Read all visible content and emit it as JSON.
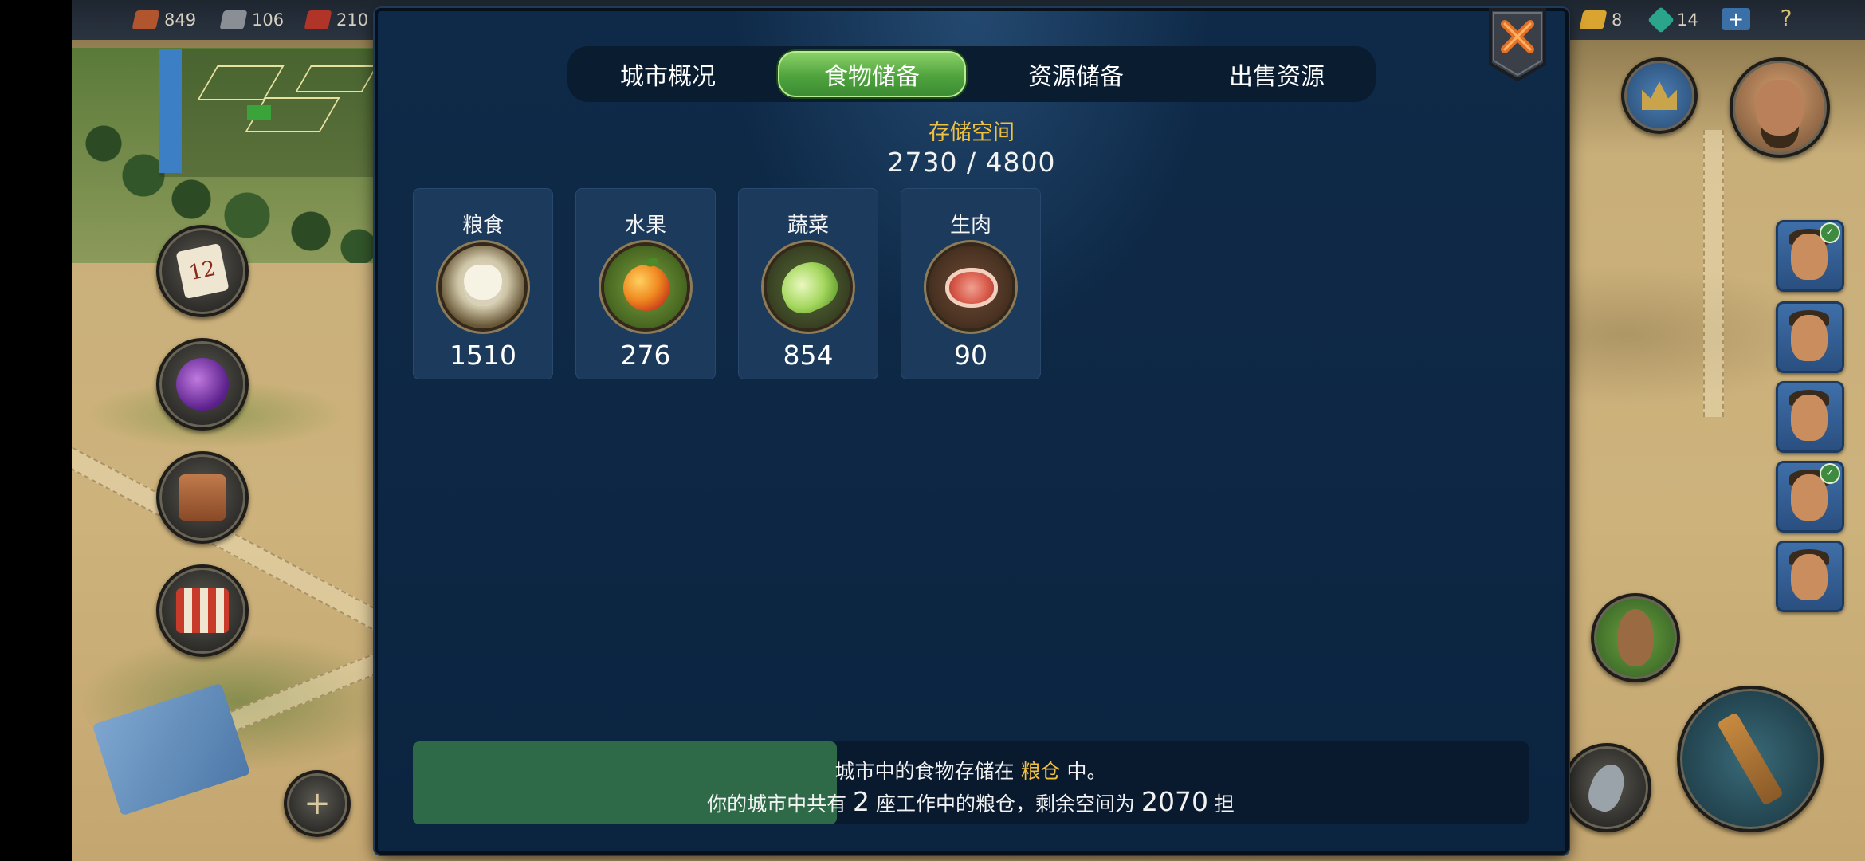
{
  "hud": {
    "resources_left": [
      {
        "icon": "wood-log-icon",
        "value": "849",
        "color": "#b0552e"
      },
      {
        "icon": "stone-icon",
        "value": "106",
        "color": "#8a8f96"
      },
      {
        "icon": "brick-icon",
        "value": "210",
        "color": "#b03428"
      }
    ],
    "resources_right": [
      {
        "icon": "gold-bar-icon",
        "value": "8",
        "color": "#d9a530"
      },
      {
        "icon": "gem-icon",
        "value": "14",
        "color": "#2aa58c"
      }
    ],
    "add_label": "+",
    "help_label": "?",
    "calendar_day": "12"
  },
  "dialog": {
    "tabs": [
      {
        "label": "城市概况",
        "active": false
      },
      {
        "label": "食物储备",
        "active": true
      },
      {
        "label": "资源储备",
        "active": false
      },
      {
        "label": "出售资源",
        "active": false
      }
    ],
    "storage": {
      "title": "存储空间",
      "value": "2730 / 4800",
      "used": 2730,
      "capacity": 4800
    },
    "items": [
      {
        "name": "粮食",
        "count": "1510",
        "icon": "grain-sack-icon"
      },
      {
        "name": "水果",
        "count": "276",
        "icon": "apple-icon"
      },
      {
        "name": "蔬菜",
        "count": "854",
        "icon": "cabbage-icon"
      },
      {
        "name": "生肉",
        "count": "90",
        "icon": "raw-meat-icon"
      }
    ],
    "info": {
      "line1_pre": "城市中的食物存储在",
      "line1_highlight": "粮仓",
      "line1_post": "中。",
      "line2_pre": "你的城市中共有",
      "line2_num": "2",
      "line2_mid": "座工作中的粮仓，剩余空间为",
      "line2_remaining": "2070",
      "line2_unit": "担",
      "progress_fraction": 0.38
    }
  },
  "colors": {
    "accent_gold": "#f0c040",
    "tab_active": "#5fb548",
    "dialog_bg": "#0c2543",
    "card_bg": "#1c3a5c"
  }
}
